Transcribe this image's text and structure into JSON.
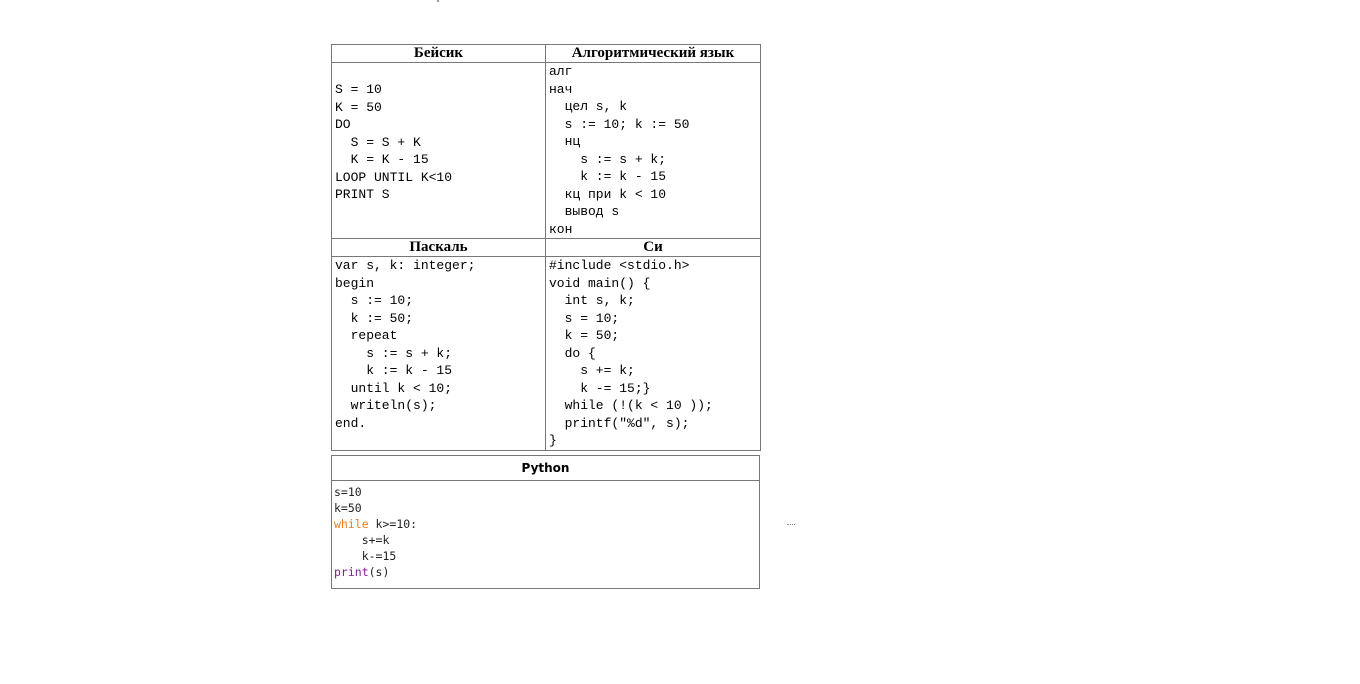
{
  "table": {
    "headers": {
      "basic": "Бейсик",
      "algo": "Алгоритмический язык",
      "pascal": "Паскаль",
      "c": "Си"
    },
    "code": {
      "basic": "S = 10\nK = 50\nDO\n  S = S + K\n  K = K - 15\nLOOP UNTIL K<10\nPRINT S",
      "algo": "алг\nнач\n  цел s, k\n  s := 10; k := 50\n  нц\n    s := s + k;\n    k := k - 15\n  кц при k < 10\n  вывод s\nкон",
      "pascal": "var s, k: integer;\nbegin\n  s := 10;\n  k := 50;\n  repeat\n    s := s + k;\n    k := k - 15\n  until k < 10;\n  writeln(s);\nend.",
      "c": "#include <stdio.h>\nvoid main() {\n  int s, k;\n  s = 10;\n  k = 50;\n  do {\n    s += k;\n    k -= 15;}\n  while (!(k < 10 ));\n  printf(\"%d\", s);\n}"
    }
  },
  "python": {
    "header": "Python",
    "lines": {
      "l1": "s=10",
      "l2": "k=50",
      "l3_kw": "while",
      "l3_rest": " k>=10:",
      "l4": "    s+=k",
      "l5": "    k-=15",
      "l6_kw": "print",
      "l6_rest": "(s)"
    },
    "colors": {
      "while_keyword": "#f07d1a",
      "print_keyword": "#7b1f8f"
    }
  }
}
